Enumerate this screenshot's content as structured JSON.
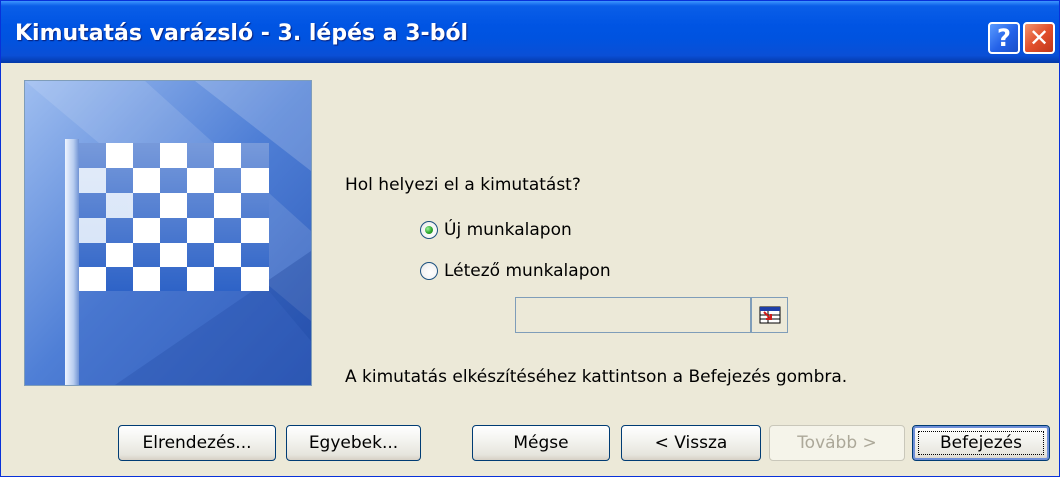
{
  "window": {
    "title": "Kimutatás varázsló - 3. lépés a 3-ból",
    "help_glyph": "?",
    "close_glyph": "✕"
  },
  "content": {
    "question": "Hol helyezi el a kimutatást?",
    "options": [
      {
        "label": "Új munkalapon",
        "selected": true
      },
      {
        "label": "Létező munkalapon",
        "selected": false
      }
    ],
    "reference_value": "",
    "hint": "A kimutatás elkészítéséhez kattintson a Befejezés gombra."
  },
  "buttons": {
    "layout": "Elrendezés...",
    "options": "Egyebek...",
    "cancel": "Mégse",
    "back": "< Vissza",
    "next": "Tovább >",
    "finish": "Befejezés"
  },
  "icons": {
    "help": "help-icon",
    "close": "close-icon",
    "collapse": "collapse-dialog-icon",
    "graphic": "checkered-flag-graphic"
  }
}
